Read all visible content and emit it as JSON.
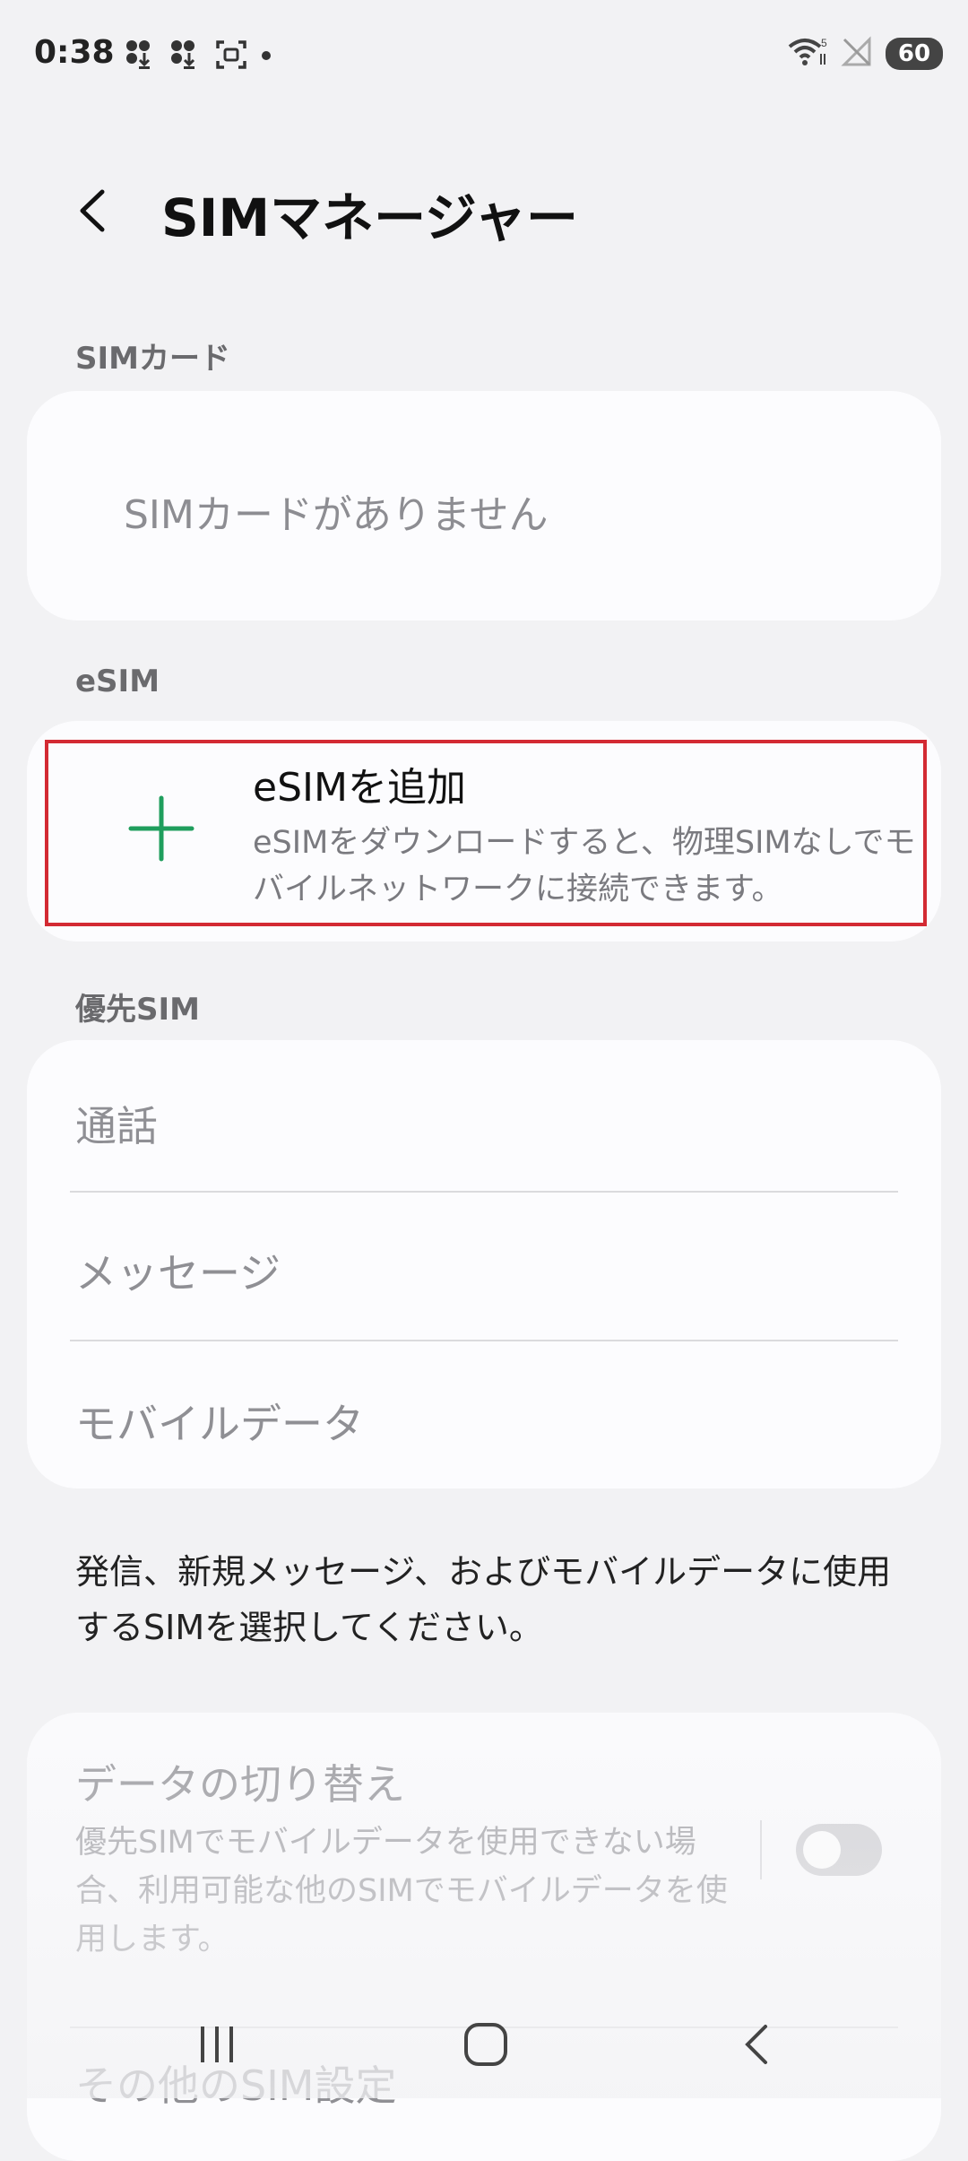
{
  "status_bar": {
    "time": "0:38",
    "battery": "60",
    "icons_left": [
      "grid-download-icon",
      "grid-download-icon",
      "screen-capture-icon",
      "dot-icon"
    ],
    "icons_right": [
      "wifi-icon",
      "no-signal-icon",
      "battery-icon"
    ]
  },
  "header": {
    "title": "SIMマネージャー",
    "back_icon": "chevron-left-icon"
  },
  "sim_card": {
    "section_label": "SIMカード",
    "empty_text": "SIMカードがありません"
  },
  "esim": {
    "section_label": "eSIM",
    "add_title": "eSIMを追加",
    "add_description": "eSIMをダウンロードすると、物理SIMなしでモバイルネットワークに接続できます。",
    "add_icon": "plus-icon",
    "accent_color": "#1f9e5d"
  },
  "preferred_sim": {
    "section_label": "優先SIM",
    "items": [
      {
        "label": "通話"
      },
      {
        "label": "メッセージ"
      },
      {
        "label": "モバイルデータ"
      }
    ],
    "info_text": "発信、新規メッセージ、およびモバイルデータに使用するSIMを選択してください。"
  },
  "data_switch": {
    "title": "データの切り替え",
    "description": "優先SIMでモバイルデータを使用できない場合、利用可能な他のSIMでモバイルデータを使用します。",
    "enabled": false
  },
  "other_settings": {
    "label": "その他のSIM設定"
  },
  "nav_bar": {
    "recents_icon": "recents-icon",
    "home_icon": "home-icon",
    "back_icon": "back-icon"
  },
  "colors": {
    "highlight_border": "#d32a33",
    "background": "#f2f2f4",
    "card": "#fcfcfe"
  }
}
